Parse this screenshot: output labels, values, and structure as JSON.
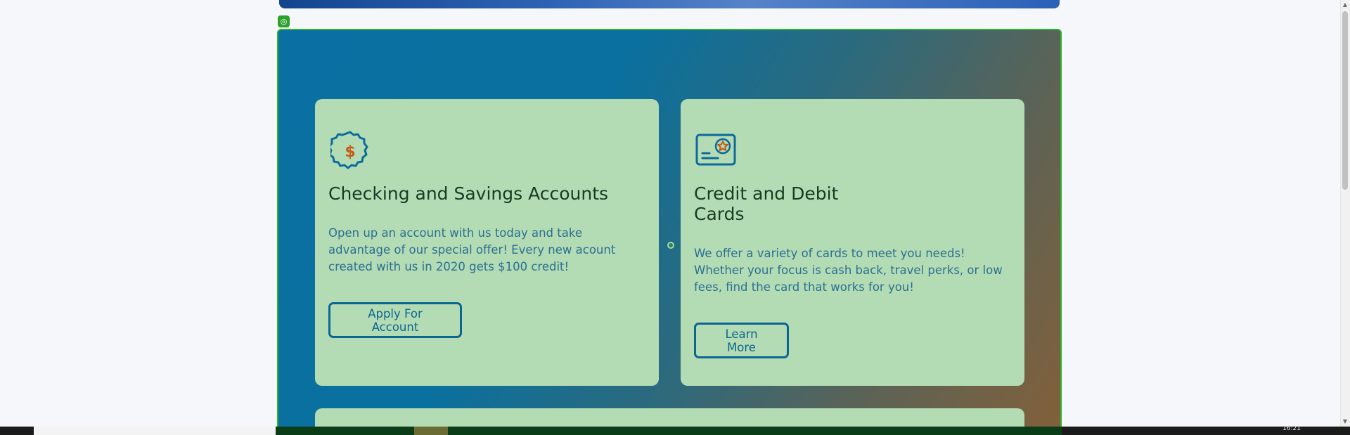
{
  "cards": [
    {
      "title": "Checking and Savings Accounts",
      "text": "Open up an account with us today and take advantage of our special offer! Every new acount created with us in 2020 gets $100 credit!",
      "button": "Apply For Account",
      "icon": "dollar-badge-icon"
    },
    {
      "title": "Credit and Debit Cards",
      "text": "We offer a variety of cards to meet you needs! Whether your focus is cash back, travel perks, or low fees, find the card that works for you!",
      "button": "Learn More",
      "icon": "credit-card-star-icon"
    }
  ],
  "taskbar": {
    "clock": "16:21"
  },
  "colors": {
    "card_bg": "#b4dcb4",
    "title": "#173c24",
    "body_text": "#2b6f92",
    "button": "#0b6591",
    "icon_primary": "#0b6a9b",
    "icon_accent": "#c45a1a",
    "selection_outline": "#2db32d"
  }
}
